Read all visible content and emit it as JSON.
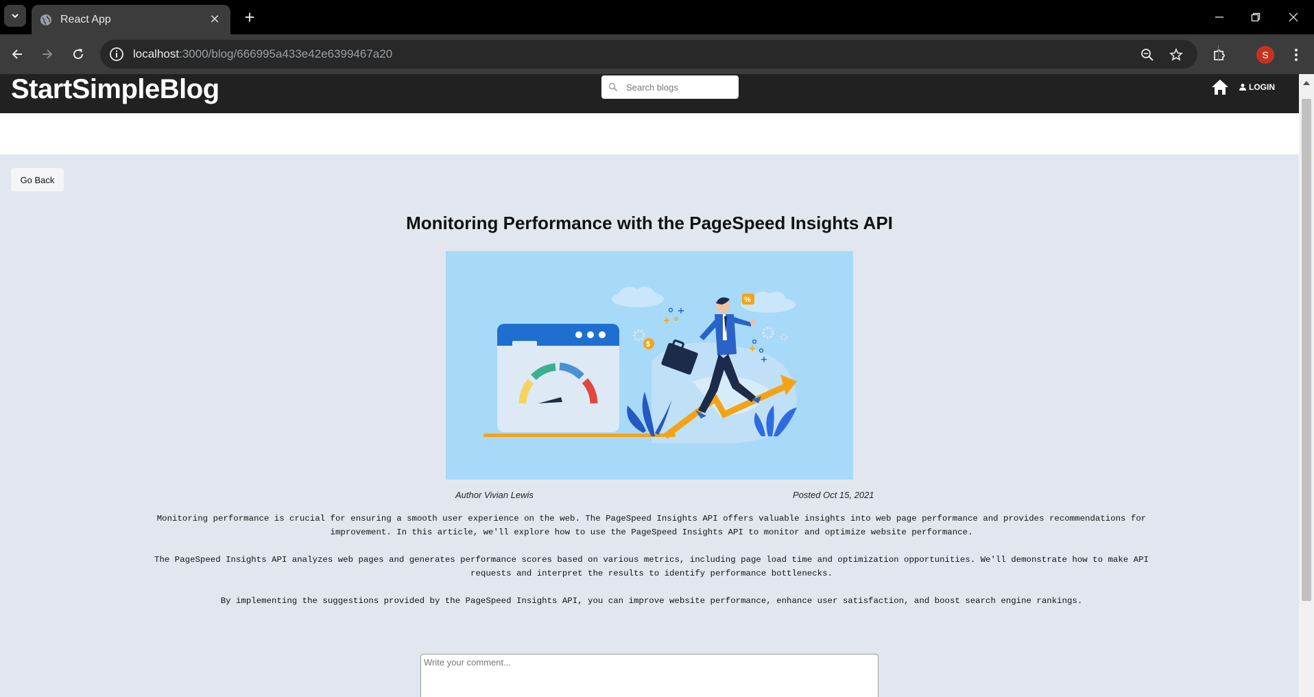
{
  "browser": {
    "tab_title": "React App",
    "url_host": "localhost",
    "url_rest": ":3000/blog/666995a433e42e6399467a20",
    "profile_initial": "S"
  },
  "header": {
    "brand": "StartSimpleBlog",
    "search_placeholder": "Search blogs",
    "login_label": "LOGIN"
  },
  "page": {
    "go_back_label": "Go Back",
    "title": "Monitoring Performance with the PageSpeed Insights API",
    "author": "Author Vivian Lewis",
    "posted": "Posted Oct 15, 2021",
    "paragraphs": [
      "Monitoring performance is crucial for ensuring a smooth user experience on the web. The PageSpeed Insights API offers valuable insights into web page performance and provides recommendations for improvement. In this article, we'll explore how to use the PageSpeed Insights API to monitor and optimize website performance.",
      "The PageSpeed Insights API analyzes web pages and generates performance scores based on various metrics, including page load time and optimization opportunities. We'll demonstrate how to make API requests and interpret the results to identify performance bottlenecks.",
      "By implementing the suggestions provided by the PageSpeed Insights API, you can improve website performance, enhance user satisfaction, and boost search engine rankings."
    ],
    "comment_placeholder": "Write your comment..."
  },
  "colors": {
    "header_bg": "#212121",
    "page_bg": "#e2e7ef",
    "hero_bg": "#a7d9f8",
    "profile_bg": "#c5331f"
  }
}
